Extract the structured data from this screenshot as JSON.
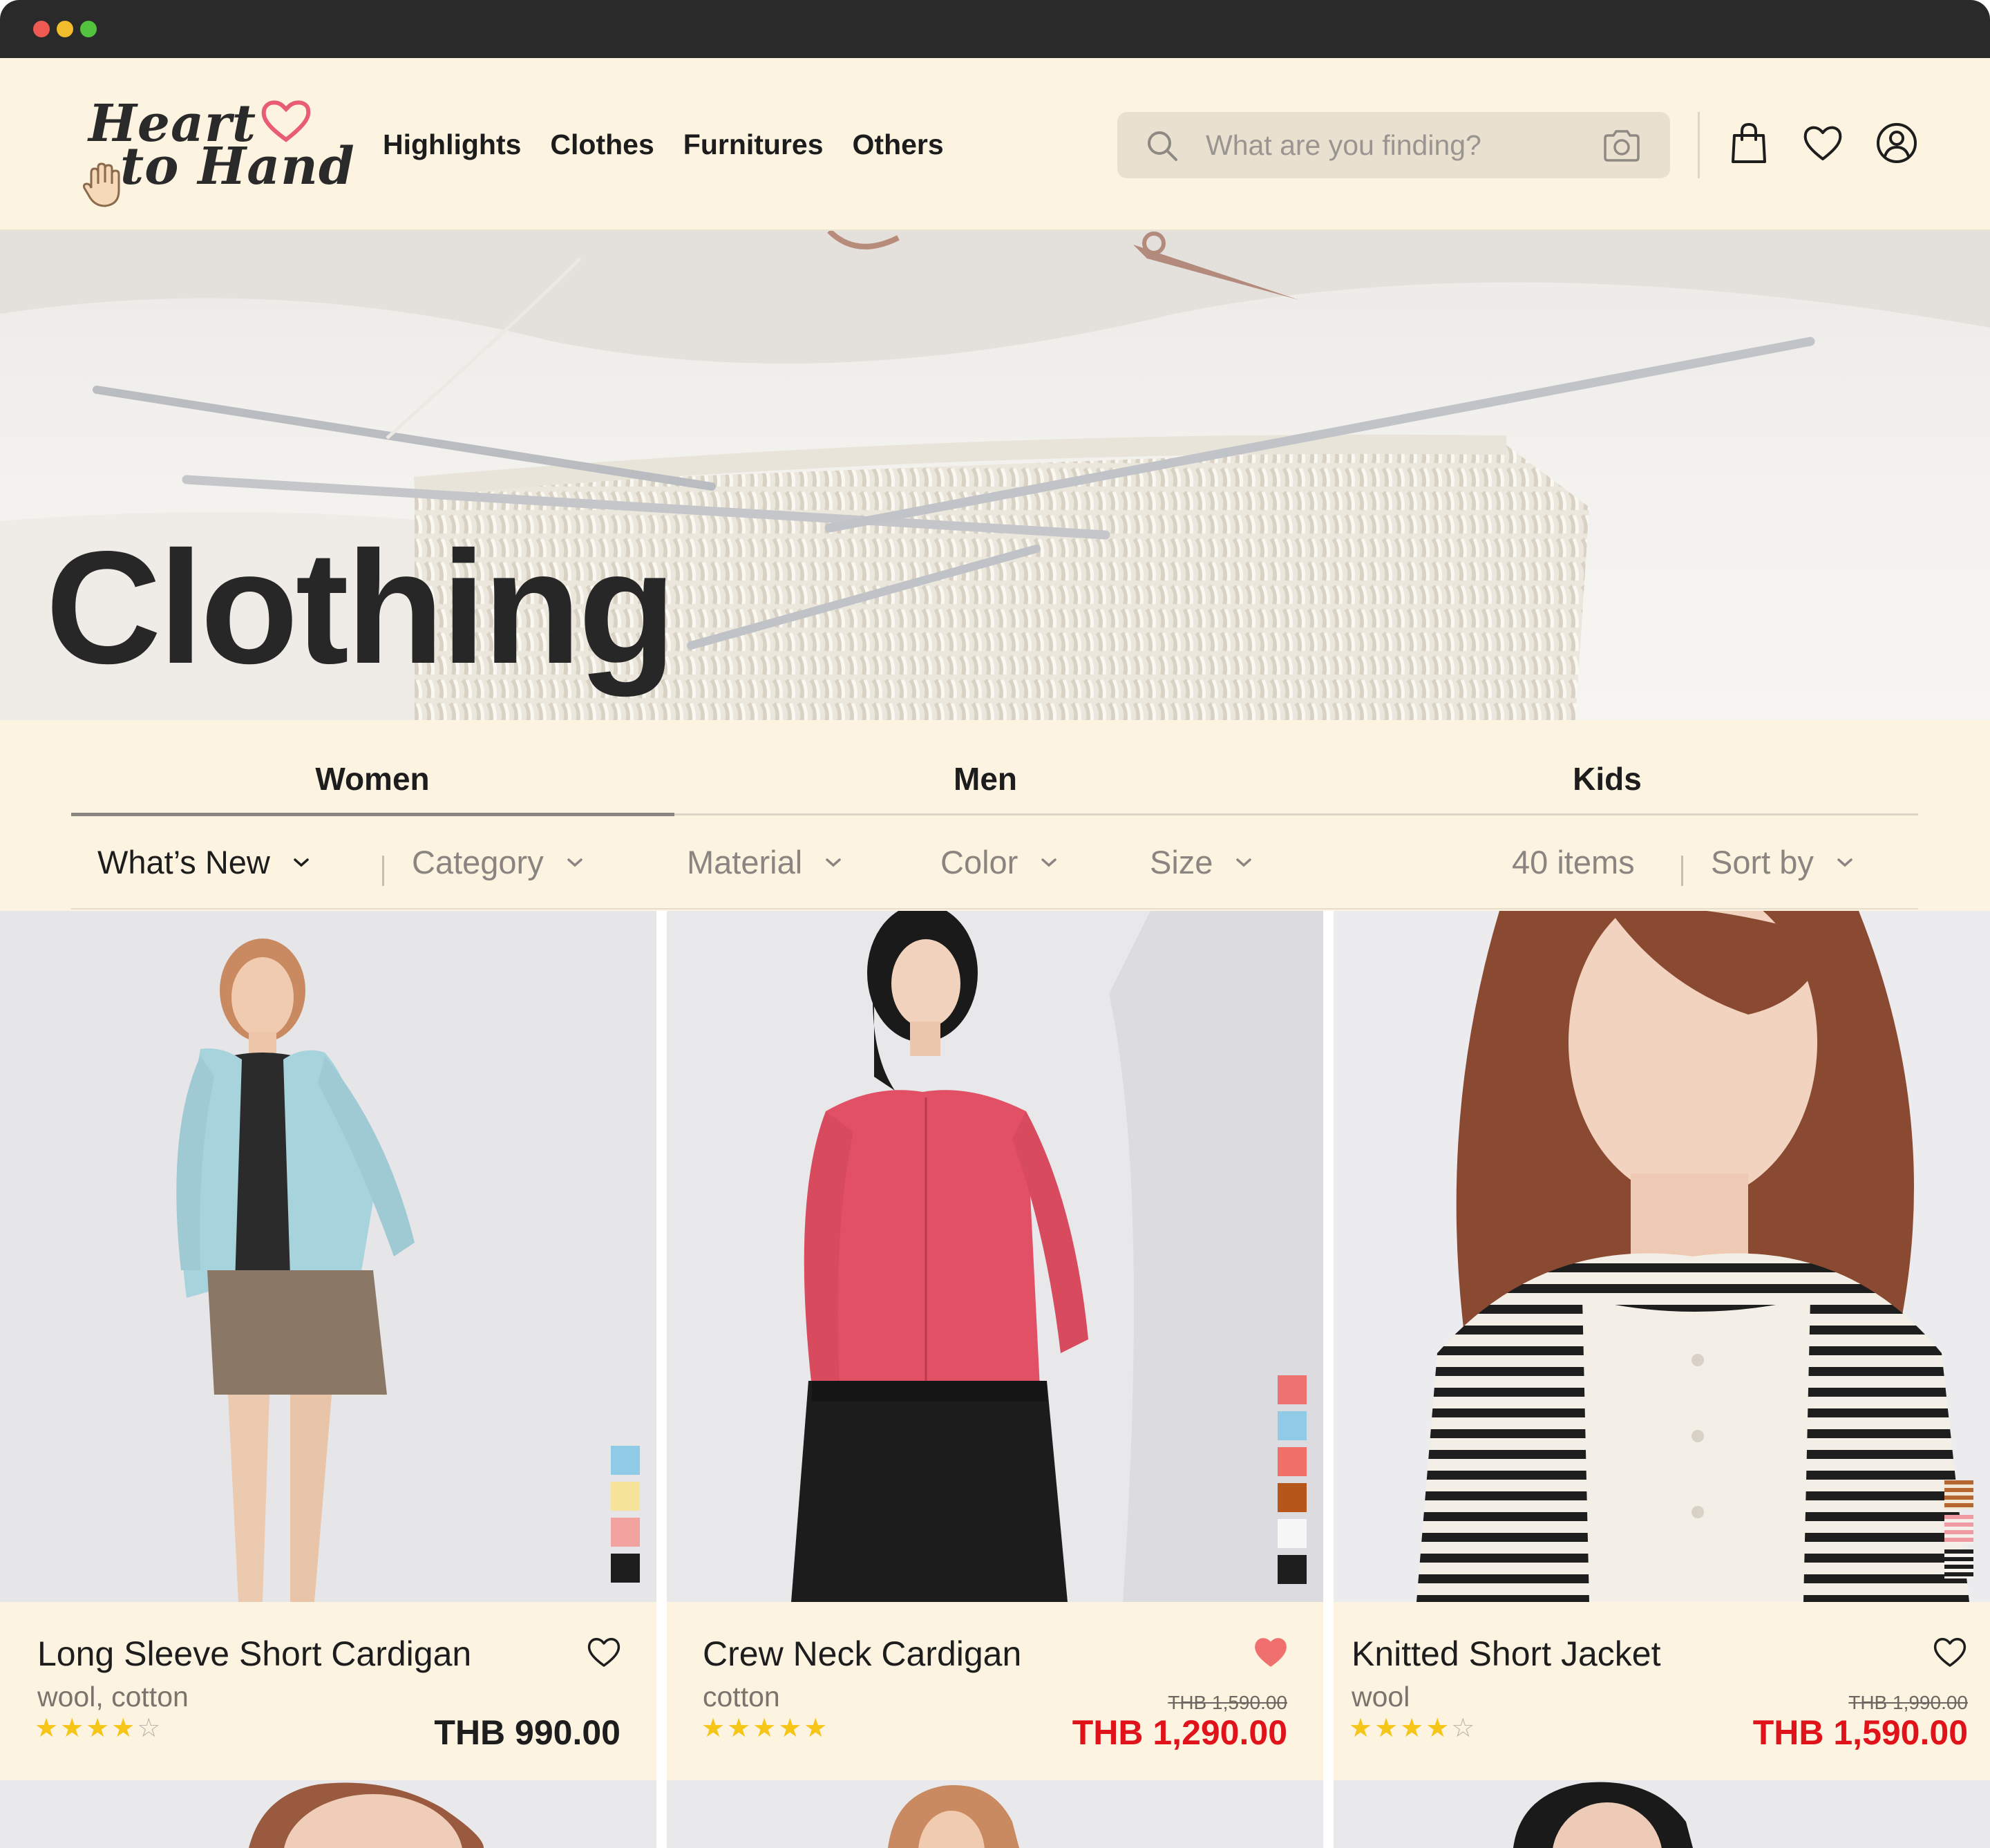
{
  "brand": {
    "line1": "Heart",
    "line2": "to Hand"
  },
  "nav": [
    "Highlights",
    "Clothes",
    "Furnitures",
    "Others"
  ],
  "search": {
    "placeholder": "What are you finding?"
  },
  "hero": {
    "title": "Clothing"
  },
  "tabs": [
    "Women",
    "Men",
    "Kids"
  ],
  "active_tab": "Women",
  "filters": {
    "whats_new": "What’s New",
    "category": "Category",
    "material": "Material",
    "color": "Color",
    "size": "Size",
    "items_count": "40 items",
    "sort": "Sort by"
  },
  "products": [
    {
      "name": "Long Sleeve Short Cardigan",
      "material": "wool, cotton",
      "rating": 4,
      "price": "THB 990.00",
      "old_price": "",
      "favorited": false,
      "swatches": [
        "#8fcbe6",
        "#f7e49b",
        "#f2a3a0",
        "#1e1e1e"
      ]
    },
    {
      "name": "Crew Neck Cardigan",
      "material": "cotton",
      "rating": 5,
      "price": "THB 1,290.00",
      "old_price": "THB 1,590.00",
      "favorited": true,
      "swatches": [
        "#ed7272",
        "#8fcbe6",
        "#f07068",
        "#b7561a",
        "#f7f7f7",
        "#1e1e1e"
      ]
    },
    {
      "name": "Knitted Short Jacket",
      "material": "wool",
      "rating": 4,
      "price": "THB 1,590.00",
      "old_price": "THB 1,990.00",
      "favorited": false,
      "swatches": [
        "striped-brown",
        "striped-pink",
        "striped-black"
      ]
    }
  ],
  "colors": {
    "cream": "#fdf3e1",
    "sale_red": "#e0131a",
    "star": "#f5c518",
    "heart_fav": "#f07070"
  }
}
